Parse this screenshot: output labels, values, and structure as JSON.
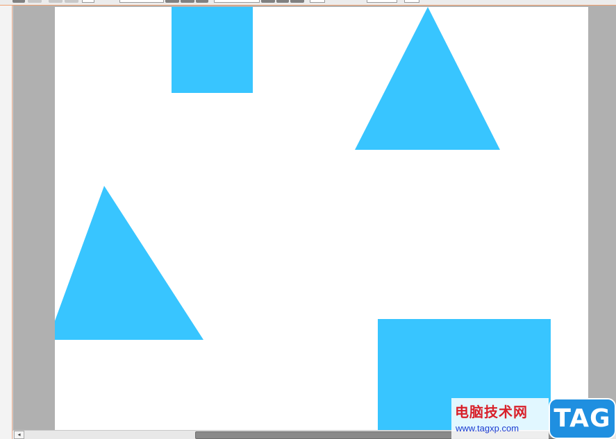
{
  "colors": {
    "shape_fill": "#38c5ff",
    "slide_background": "#ffffff",
    "workspace_gray": "#b0b0b0",
    "scrollbar_thumb": "#8a8a8a",
    "watermark_red": "#d8202a",
    "watermark_blue": "#1f8fe0"
  },
  "shapes": [
    {
      "kind": "rectangle"
    },
    {
      "kind": "isosceles-triangle"
    },
    {
      "kind": "isosceles-triangle"
    },
    {
      "kind": "rectangle"
    }
  ],
  "scrollbar": {
    "left_arrow_glyph": "◂"
  },
  "watermark": {
    "chinese": "电脑技术网",
    "url": "www.tagxp.com",
    "badge": "TAG"
  }
}
